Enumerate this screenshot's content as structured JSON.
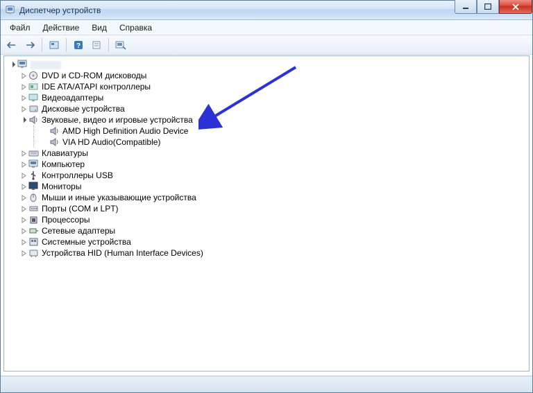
{
  "window": {
    "title": "Диспетчер устройств"
  },
  "menu": {
    "file": "Файл",
    "action": "Действие",
    "view": "Вид",
    "help": "Справка"
  },
  "tree": {
    "root": "",
    "items": [
      {
        "label": "DVD и CD-ROM дисководы",
        "icon": "disc"
      },
      {
        "label": "IDE ATA/ATAPI контроллеры",
        "icon": "ide"
      },
      {
        "label": "Видеоадаптеры",
        "icon": "display"
      },
      {
        "label": "Дисковые устройства",
        "icon": "hdd"
      },
      {
        "label": "Звуковые, видео и игровые устройства",
        "icon": "speaker",
        "expanded": true,
        "children": [
          {
            "label": "AMD High Definition Audio Device",
            "icon": "speaker"
          },
          {
            "label": "VIA HD Audio(Compatible)",
            "icon": "speaker"
          }
        ]
      },
      {
        "label": "Клавиатуры",
        "icon": "keyboard"
      },
      {
        "label": "Компьютер",
        "icon": "computer"
      },
      {
        "label": "Контроллеры USB",
        "icon": "usb"
      },
      {
        "label": "Мониторы",
        "icon": "monitor"
      },
      {
        "label": "Мыши и иные указывающие устройства",
        "icon": "mouse"
      },
      {
        "label": "Порты (COM и LPT)",
        "icon": "port"
      },
      {
        "label": "Процессоры",
        "icon": "cpu"
      },
      {
        "label": "Сетевые адаптеры",
        "icon": "net"
      },
      {
        "label": "Системные устройства",
        "icon": "system"
      },
      {
        "label": "Устройства HID (Human Interface Devices)",
        "icon": "hid"
      }
    ]
  }
}
